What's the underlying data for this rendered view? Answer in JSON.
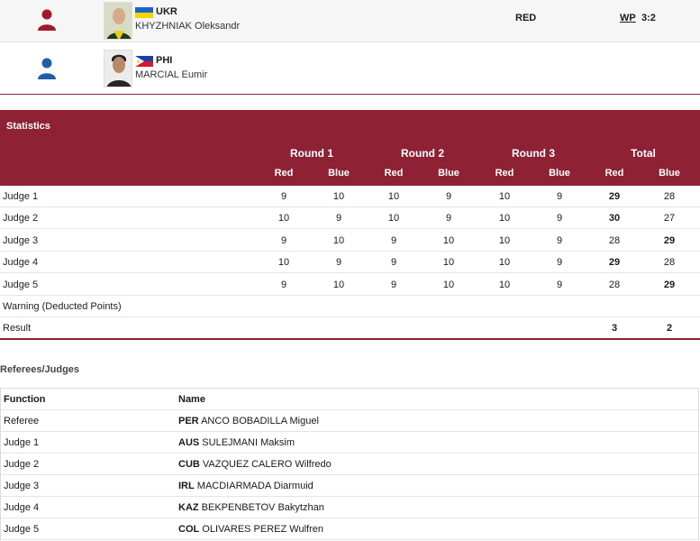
{
  "red": {
    "noc": "UKR",
    "name": "KHYZHNIAK Oleksandr",
    "corner": "RED",
    "decision": "WP",
    "score": "3:2",
    "color": "#a3172e"
  },
  "blue": {
    "noc": "PHI",
    "name": "MARCIAL Eumir",
    "color": "#1f5fa8"
  },
  "stats": {
    "title": "Statistics",
    "rounds": [
      "Round 1",
      "Round 2",
      "Round 3",
      "Total"
    ],
    "corners": [
      "Red",
      "Blue",
      "Red",
      "Blue",
      "Red",
      "Blue",
      "Red",
      "Blue"
    ],
    "rows": [
      {
        "label": "Judge 1",
        "values": [
          "9",
          "10",
          "10",
          "9",
          "10",
          "9",
          "29",
          "28"
        ],
        "bold": [
          6
        ]
      },
      {
        "label": "Judge 2",
        "values": [
          "10",
          "9",
          "10",
          "9",
          "10",
          "9",
          "30",
          "27"
        ],
        "bold": [
          6
        ]
      },
      {
        "label": "Judge 3",
        "values": [
          "9",
          "10",
          "9",
          "10",
          "10",
          "9",
          "28",
          "29"
        ],
        "bold": [
          7
        ]
      },
      {
        "label": "Judge 4",
        "values": [
          "10",
          "9",
          "9",
          "10",
          "10",
          "9",
          "29",
          "28"
        ],
        "bold": [
          6
        ]
      },
      {
        "label": "Judge 5",
        "values": [
          "9",
          "10",
          "9",
          "10",
          "10",
          "9",
          "28",
          "29"
        ],
        "bold": [
          7
        ]
      },
      {
        "label": "Warning (Deducted Points)",
        "values": [
          "",
          "",
          "",
          "",
          "",
          "",
          "",
          ""
        ],
        "bold": []
      },
      {
        "label": "Result",
        "values": [
          "",
          "",
          "",
          "",
          "",
          "",
          "3",
          "2"
        ],
        "bold": [
          6,
          7
        ]
      }
    ]
  },
  "referees": {
    "title": "Referees/Judges",
    "col_function": "Function",
    "col_name": "Name",
    "rows": [
      {
        "function": "Referee",
        "noc": "PER",
        "name": "ANCO BOBADILLA Miguel"
      },
      {
        "function": "Judge 1",
        "noc": "AUS",
        "name": "SULEJMANI Maksim"
      },
      {
        "function": "Judge 2",
        "noc": "CUB",
        "name": "VAZQUEZ CALERO Wilfredo"
      },
      {
        "function": "Judge 3",
        "noc": "IRL",
        "name": "MACDIARMADA Diarmuid"
      },
      {
        "function": "Judge 4",
        "noc": "KAZ",
        "name": "BEKPENBETOV Bakytzhan"
      },
      {
        "function": "Judge 5",
        "noc": "COL",
        "name": "OLIVARES PEREZ Wulfren"
      }
    ]
  }
}
